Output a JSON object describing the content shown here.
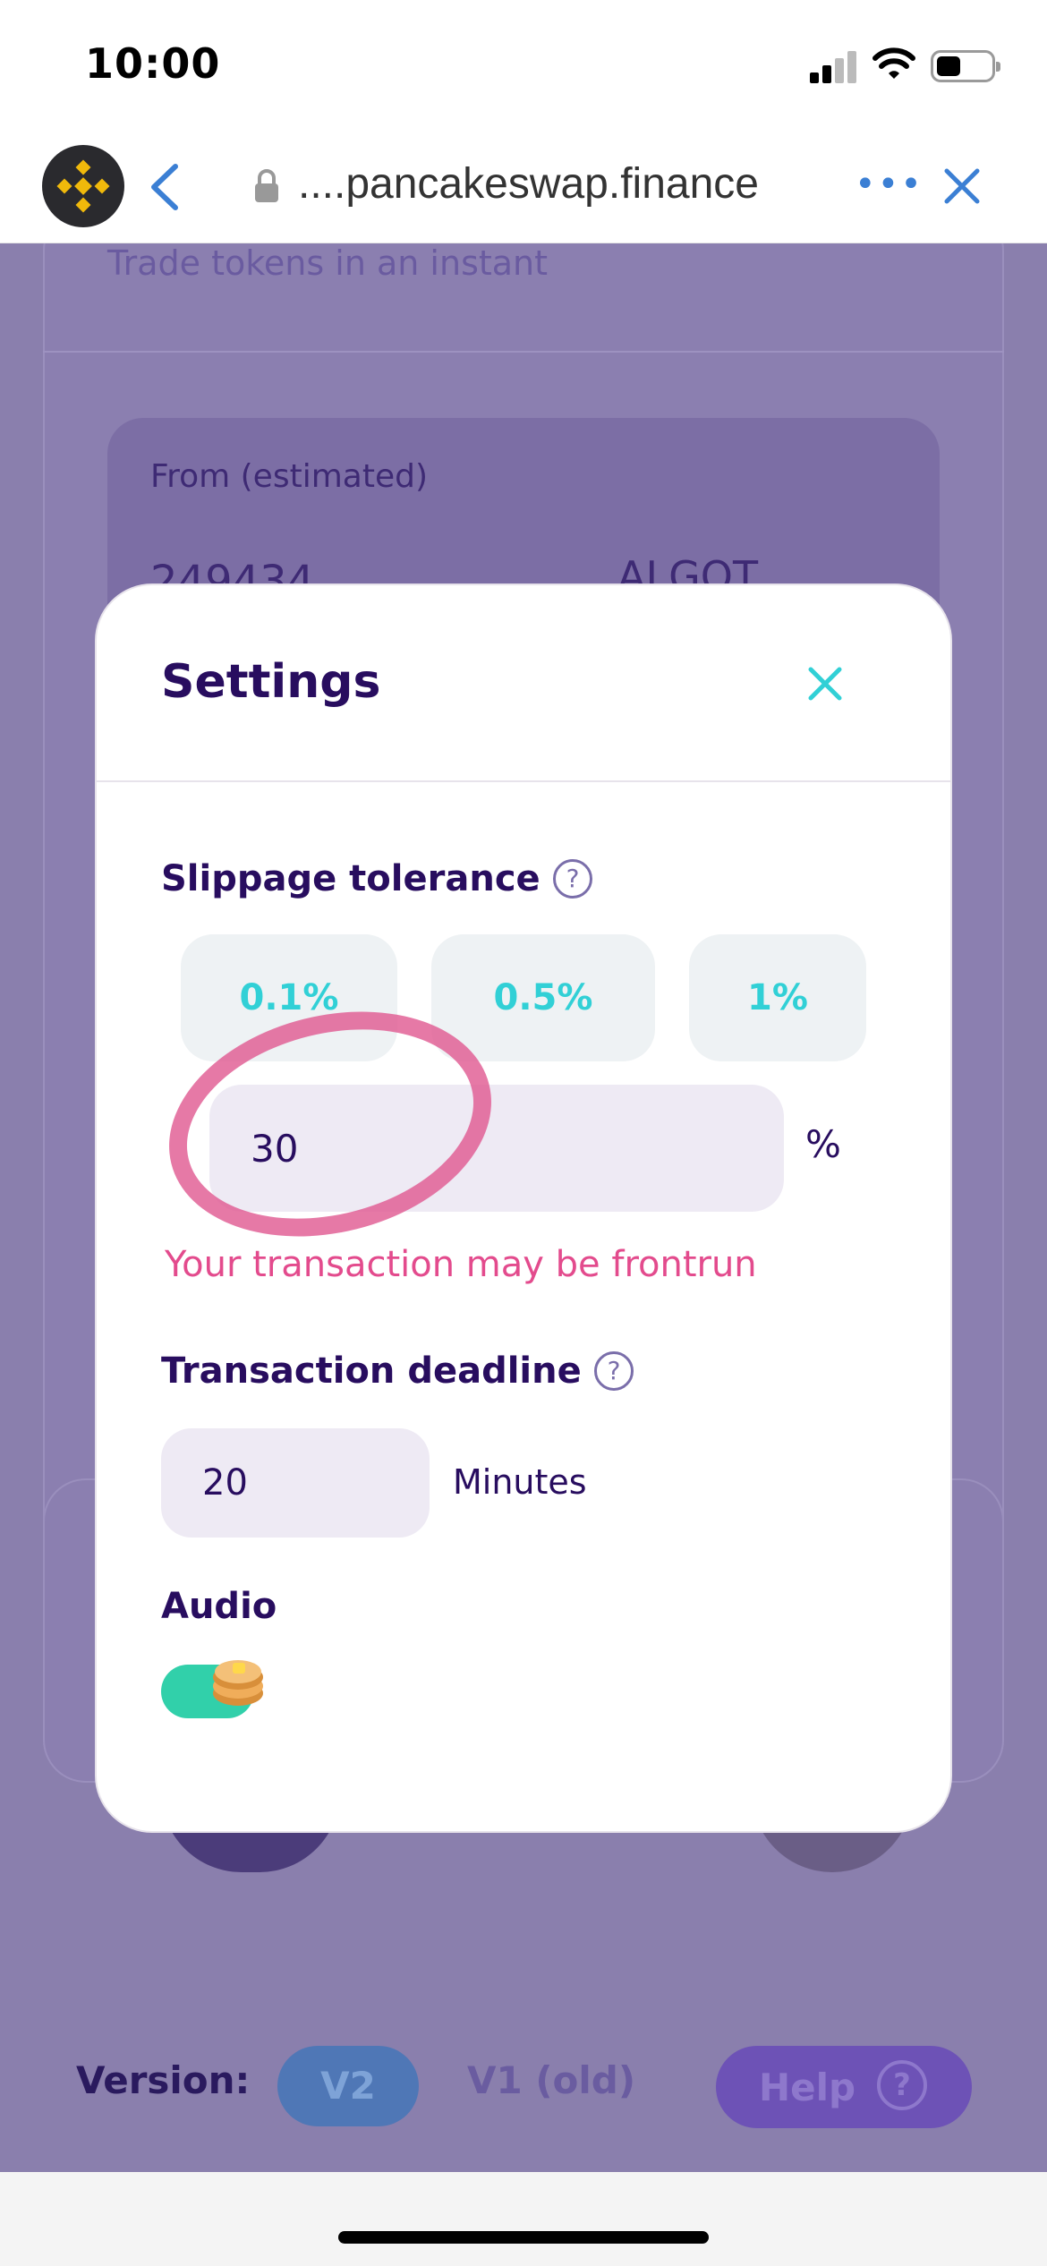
{
  "status_bar": {
    "time": "10:00"
  },
  "browser": {
    "url": "....pancakeswap.finance"
  },
  "background_page": {
    "subtitle": "Trade tokens in an instant",
    "from_label": "From (estimated)",
    "from_amount": "249434",
    "token": "ALGOT",
    "version_label": "Version:",
    "v2_label": "V2",
    "v1_label": "V1 (old)",
    "help_label": "Help"
  },
  "settings": {
    "title": "Settings",
    "slippage_title": "Slippage tolerance",
    "presets": [
      "0.1%",
      "0.5%",
      "1%"
    ],
    "slippage_value": "30",
    "percent_sign": "%",
    "warning": "Your transaction may be frontrun",
    "deadline_title": "Transaction deadline",
    "deadline_value": "20",
    "deadline_unit": "Minutes",
    "audio_title": "Audio",
    "audio_enabled": true
  },
  "colors": {
    "accent": "#31d0aa",
    "preset_text": "#31d0d6",
    "title": "#280d5f",
    "warning": "#e34b8d",
    "overlay": "#8a7fad"
  }
}
